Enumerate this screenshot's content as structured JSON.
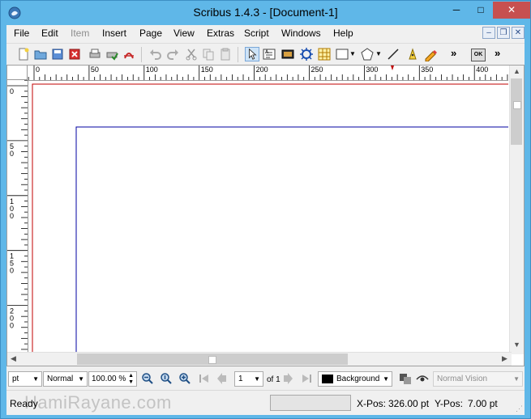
{
  "window": {
    "title": "Scribus 1.4.3 - [Document-1]",
    "minimize_glyph": "─",
    "maximize_glyph": "□",
    "close_glyph": "✕"
  },
  "menu": {
    "items": [
      {
        "label": "File",
        "enabled": true
      },
      {
        "label": "Edit",
        "enabled": true
      },
      {
        "label": "Item",
        "enabled": false
      },
      {
        "label": "Insert",
        "enabled": true
      },
      {
        "label": "Page",
        "enabled": true
      },
      {
        "label": "View",
        "enabled": true
      },
      {
        "label": "Extras",
        "enabled": true
      },
      {
        "label": "Script",
        "enabled": true
      },
      {
        "label": "Windows",
        "enabled": true
      },
      {
        "label": "Help",
        "enabled": true
      }
    ],
    "mdi_minimize": "–",
    "mdi_restore": "❐",
    "mdi_close": "✕"
  },
  "toolbar": {
    "overflow_glyph": "»",
    "ok_label": "OK"
  },
  "ruler": {
    "h_labels": [
      "0",
      "50",
      "100",
      "150",
      "200",
      "250",
      "300",
      "350",
      "400"
    ],
    "v_labels": [
      "0",
      "50",
      "100",
      "150",
      "200"
    ]
  },
  "colors": {
    "bleed_line": "#c00000",
    "margin_line": "#0000a0",
    "accent": "#5fb7e8"
  },
  "bottom_toolbar": {
    "unit": "pt",
    "quality": "Normal",
    "zoom": "100.00 %",
    "page_number": "1",
    "page_of": "of 1",
    "layer": "Background",
    "vision": "Normal Vision"
  },
  "status": {
    "ready": "Ready",
    "xpos_label": "X-Pos:",
    "xpos_value": "326.00 pt",
    "ypos_label": "Y-Pos:",
    "ypos_value": "7.00 pt"
  },
  "watermark": "HamiRayane.com"
}
